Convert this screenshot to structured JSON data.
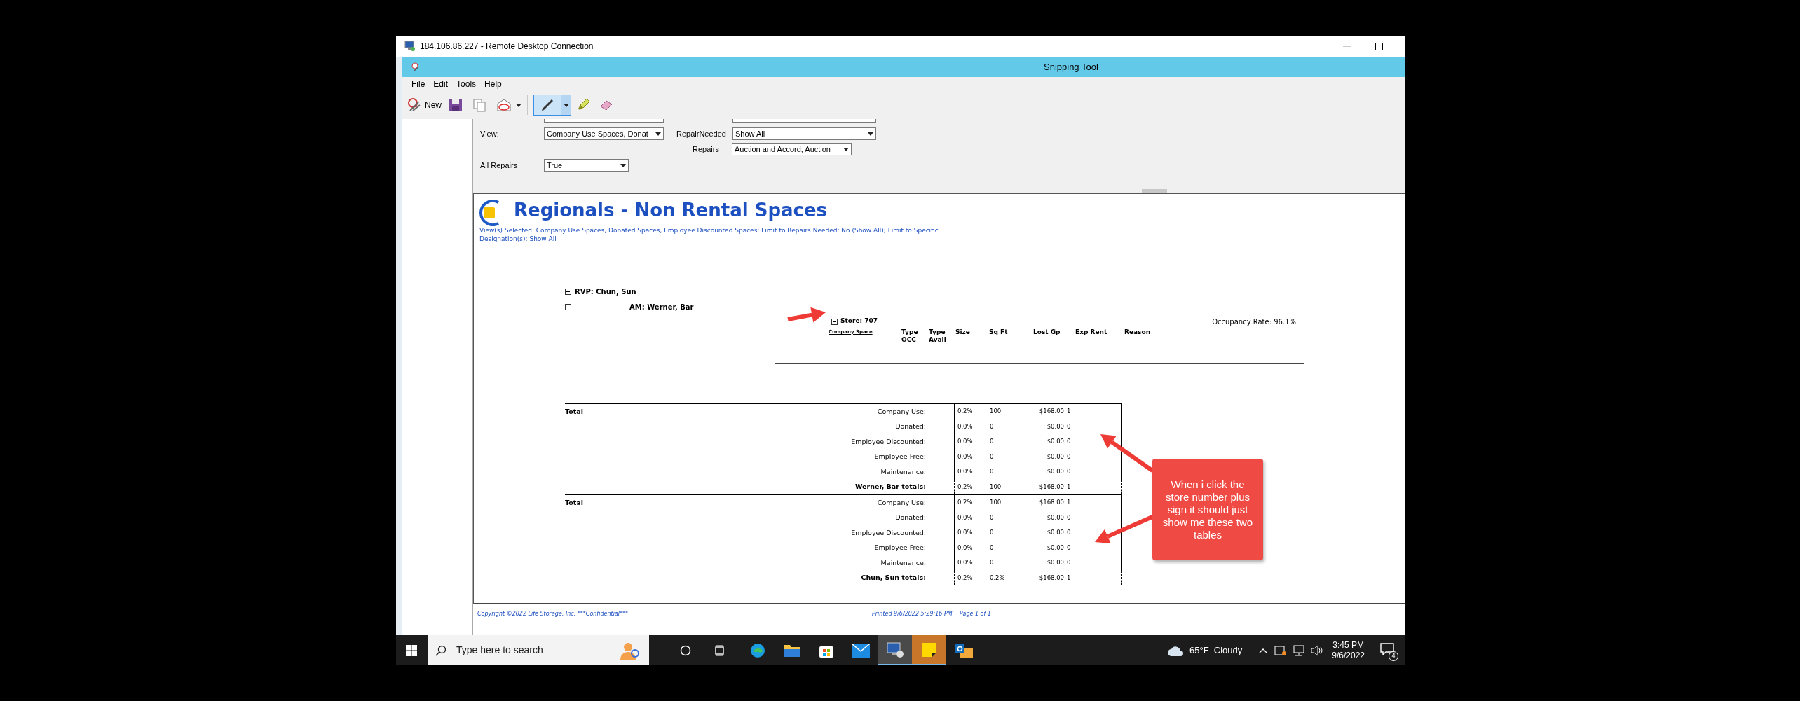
{
  "rdp_window": {
    "title": "184.106.86.227 - Remote Desktop Connection"
  },
  "snipping_tool": {
    "title": "Snipping Tool",
    "menu": [
      "File",
      "Edit",
      "Tools",
      "Help"
    ],
    "new_label": "New",
    "tools": [
      {
        "kind": "pen",
        "selected": true
      },
      {
        "kind": "highlighter",
        "selected": false
      },
      {
        "kind": "eraser",
        "selected": false
      }
    ]
  },
  "filters": [
    {
      "label": "View:",
      "value": "Company Use Spaces, Donat"
    },
    {
      "label": "RepairNeeded",
      "value": "Show All"
    },
    {
      "label": "Repairs",
      "value": "Auction and Accord, Auction"
    },
    {
      "label": "All Repairs",
      "value": "True"
    }
  ],
  "report": {
    "title": "Regionals - Non Rental Spaces",
    "subtitle": "View(s) Selected: Company Use Spaces, Donated Spaces, Employee Discounted Spaces; Limit to Repairs Needed: No (Show All); Limit to Specific Designation(s): Show All",
    "groups": [
      {
        "label": "RVP: Chun, Sun",
        "expanded": false
      },
      {
        "label": "AM: Werner, Bar",
        "expanded": false
      }
    ],
    "store": {
      "label": "Store: 707",
      "expanded": true
    },
    "occupancy": "Occupancy Rate: 96.1%",
    "columns": [
      "Company Space",
      "Type OCC",
      "Type Avail",
      "Size",
      "Sq Ft",
      "Lost Gp",
      "Exp Rent",
      "Reason"
    ],
    "totals": [
      {
        "heading": "Total",
        "rows": [
          {
            "label": "Company Use:",
            "size": "0.2%",
            "sq_ft": "100",
            "lost": "$168.00",
            "count": "1",
            "kind": "row"
          },
          {
            "label": "Donated:",
            "size": "0.0%",
            "sq_ft": "0",
            "lost": "$0.00",
            "count": "0",
            "kind": "row"
          },
          {
            "label": "Employee Discounted:",
            "size": "0.0%",
            "sq_ft": "0",
            "lost": "$0.00",
            "count": "0",
            "kind": "row"
          },
          {
            "label": "Employee Free:",
            "size": "0.0%",
            "sq_ft": "0",
            "lost": "$0.00",
            "count": "0",
            "kind": "row"
          },
          {
            "label": "Maintenance:",
            "size": "0.0%",
            "sq_ft": "0",
            "lost": "$0.00",
            "count": "0",
            "kind": "row"
          },
          {
            "label": "Werner, Bar totals:",
            "size": "0.2%",
            "sq_ft": "100",
            "lost": "$168.00",
            "count": "1",
            "kind": "summary"
          }
        ]
      },
      {
        "heading": "Total",
        "rows": [
          {
            "label": "Company Use:",
            "size": "0.2%",
            "sq_ft": "100",
            "lost": "$168.00",
            "count": "1",
            "kind": "row"
          },
          {
            "label": "Donated:",
            "size": "0.0%",
            "sq_ft": "0",
            "lost": "$0.00",
            "count": "0",
            "kind": "row"
          },
          {
            "label": "Employee Discounted:",
            "size": "0.0%",
            "sq_ft": "0",
            "lost": "$0.00",
            "count": "0",
            "kind": "row"
          },
          {
            "label": "Employee Free:",
            "size": "0.0%",
            "sq_ft": "0",
            "lost": "$0.00",
            "count": "0",
            "kind": "row"
          },
          {
            "label": "Maintenance:",
            "size": "0.0%",
            "sq_ft": "0",
            "lost": "$0.00",
            "count": "0",
            "kind": "row"
          },
          {
            "label": "Chun, Sun totals:",
            "size": "0.2%",
            "sq_ft": "0.2%",
            "lost": "$168.00",
            "count": "1",
            "kind": "summary"
          }
        ]
      }
    ]
  },
  "footer": {
    "copyright": "Copyright ©2022 Life Storage, Inc. ***Confidential***",
    "printed": "Printed 9/6/2022 5:29:16 PM",
    "page": "Page 1 of 1"
  },
  "annotation": {
    "text": "When i click the store number plus sign it should just show me these two tables"
  },
  "taskbar": {
    "search_placeholder": "Type here to search",
    "apps": [
      {
        "kind": "edge",
        "active": false,
        "flashing": false
      },
      {
        "kind": "explorer",
        "active": false,
        "flashing": false
      },
      {
        "kind": "store",
        "active": false,
        "flashing": false
      },
      {
        "kind": "mail",
        "active": false,
        "flashing": false
      },
      {
        "kind": "remote",
        "active": true,
        "flashing": false
      },
      {
        "kind": "notes",
        "active": false,
        "flashing": true
      },
      {
        "kind": "outlook",
        "active": false,
        "flashing": false
      }
    ],
    "weather": "65°F  Cloudy",
    "time": "3:45 PM",
    "date": "9/6/2022",
    "notifications": "4"
  }
}
